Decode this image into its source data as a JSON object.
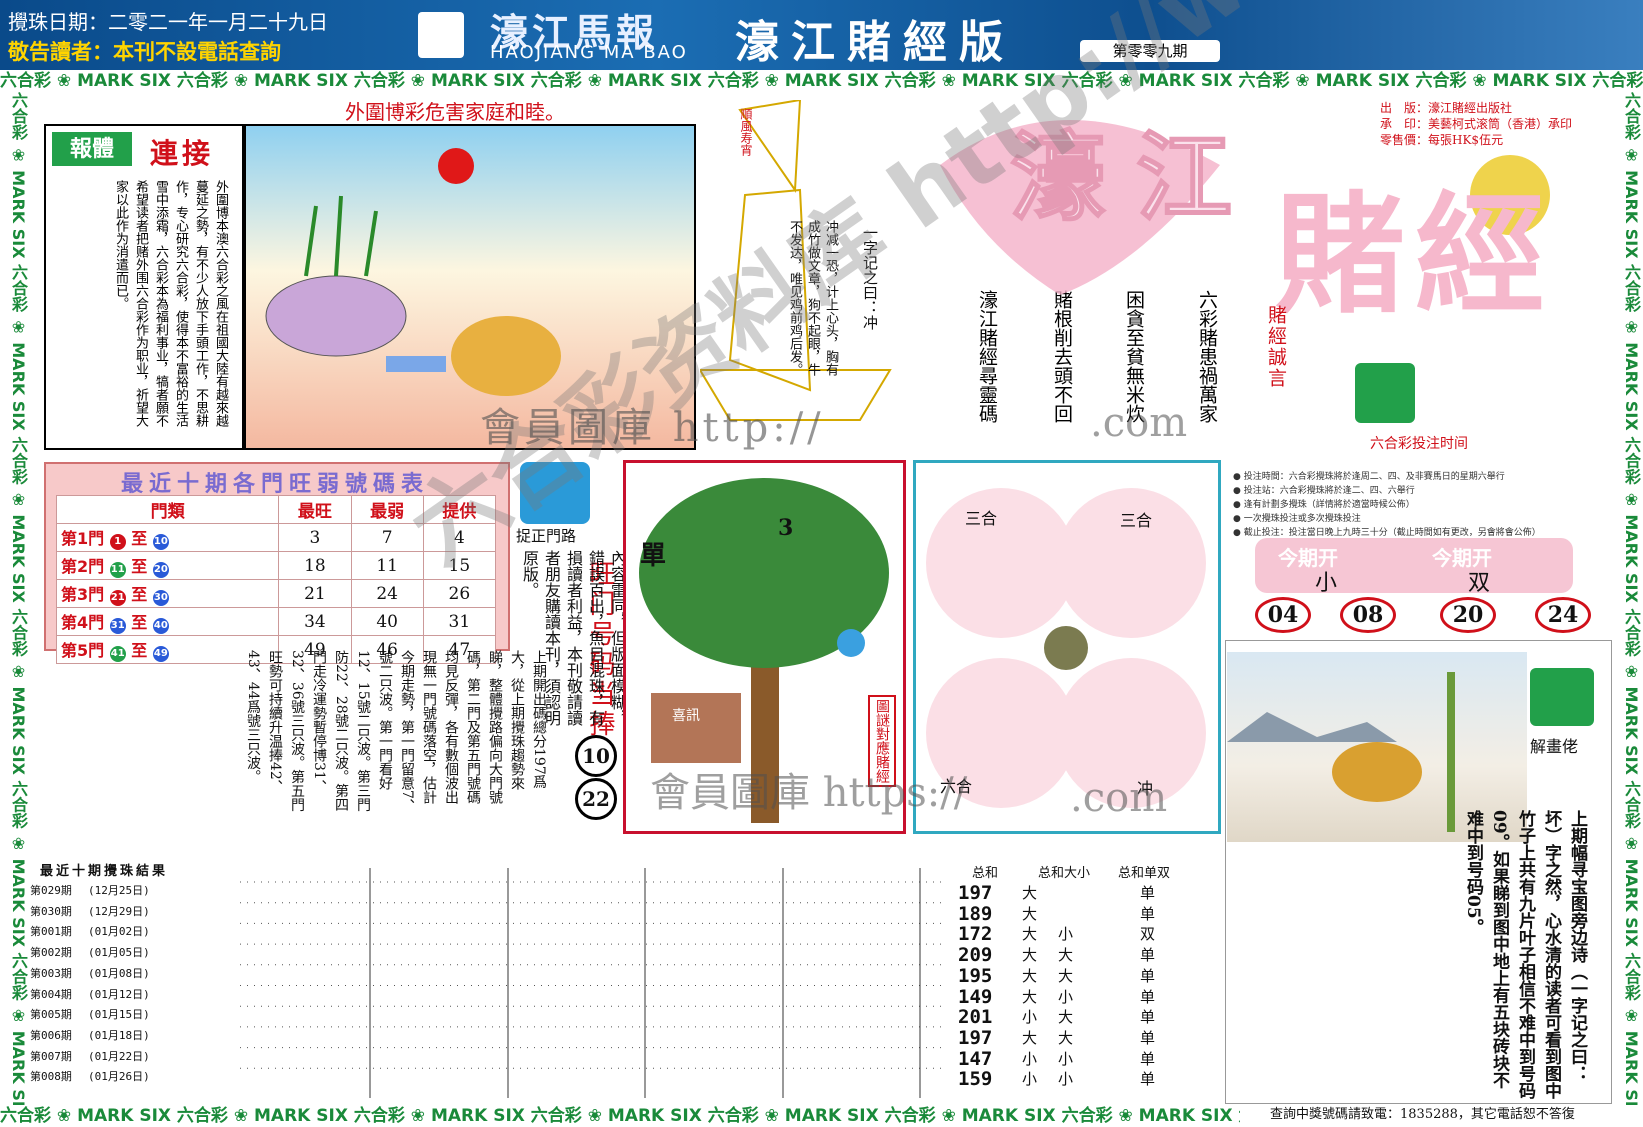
{
  "header": {
    "date_line": "攪珠日期：二零二一年一月二十九日",
    "notice": "敬告讀者：本刊不設電話查詢",
    "logo_cn": "濠江馬報",
    "logo_en": "HAOJIANG MA BAO",
    "edition": "濠江賭經版",
    "issue": "第零零九期"
  },
  "border": {
    "unit": "六合彩 ❀ MARK SIX "
  },
  "slogan": "外圍博彩危害家庭和睦。",
  "article": {
    "badge": "報體",
    "heading": "連接",
    "body": "外圍博本澳六合彩之風在祖國大陸有越來越蔓延之勢，有不少人放下手頭工作，不思耕作，专心研究六合彩，使得本不富裕的生活雪中添霜，六合彩本為福利事业，犒者願不希望读者把赌外围六合彩作为职业，祈望大家以此作为消遣而已。"
  },
  "boat": {
    "flag": "順風寿宵",
    "title": "一字记之曰：冲",
    "poem": "冲减一恐，计上心头，胸有成竹做文章，狗不起眼，牛不发达，唯见鸡前鸡后发。"
  },
  "verses": [
    "六彩賭患禍萬家",
    "困貪至貧無米炊",
    "賭根削去頭不回",
    "濠江賭經尋靈碼"
  ],
  "logo": {
    "big1": "濠江",
    "big2": "賭經",
    "motto": "賭經誠言",
    "bet_time": "六合彩投注时间"
  },
  "pub_info": [
    "出　版：濠江賭經出版社",
    "承　印：美藝柯式滚筒（香港）承印",
    "零售價：每張HK$伍元"
  ],
  "rank_table": {
    "title": "最近十期各門旺弱號碼表",
    "headers": [
      "門類",
      "最旺",
      "最弱",
      "提供"
    ],
    "rows": [
      {
        "gate": "第1門",
        "a": "1",
        "b": "10",
        "hot": "3",
        "weak": "7",
        "offer": "4"
      },
      {
        "gate": "第2門",
        "a": "11",
        "b": "20",
        "hot": "18",
        "weak": "11",
        "offer": "15"
      },
      {
        "gate": "第3門",
        "a": "21",
        "b": "30",
        "hot": "21",
        "weak": "24",
        "offer": "26"
      },
      {
        "gate": "第4門",
        "a": "31",
        "b": "40",
        "hot": "34",
        "weak": "40",
        "offer": "31"
      },
      {
        "gate": "第5門",
        "a": "41",
        "b": "49",
        "hot": "49",
        "weak": "46",
        "offer": "47"
      }
    ],
    "to": "至"
  },
  "gate_route": {
    "label": "捉正門路",
    "hot_title": "旺门号码当捧",
    "nums": [
      "10",
      "22"
    ],
    "notice": "敬告讀者：近期發現內地市場上有本刊的翻版，雖內容雷同，但版面模糊，錯誤百出，魚目混珠，有損讀者利益，本刊敬請讀者朋友購讀本刊，須認明原版。",
    "long": "上期開出碼總分197爲大，從上期攪珠趨勢來睇，整體攪路偏向大門號碼，第二門及第五門號碼均見反彈，各有數個波出現無一門號碼落空，估計今期走勢，第一門留意7、號二只波。第一門看好12、15號二只波。第三門防22、28號二只波。第四門走冷運勢暫停博31、32、36號三只波。第五門旺勢可持續升温捧42、43、44爲號三只波。"
  },
  "tree": {
    "left": "單",
    "num": "3",
    "side": "圖謎對應賭經",
    "caption": "喜訊"
  },
  "zodiac": {
    "tl": "三合",
    "tr": "三合",
    "bl": "六合",
    "br": "冲"
  },
  "bet_rules": [
    "● 投注時間：六合彩攪珠將於逢周二、四、及非賽馬日的星期六舉行",
    "● 投注站：六合彩攪珠將於逢二、四、六舉行",
    "● 逢有計劃多攪珠（詳情將於適當時候公佈）",
    "● 一次攪珠投注或多次攪珠投注",
    "● 截止投注：投注當日晚上九時三十分（截止時間如有更改，另會將會公佈）"
  ],
  "result_panel": {
    "hdr1": "今期开",
    "hdr2": "今期开",
    "val1": "小",
    "val2": "双",
    "balls": [
      "04",
      "08",
      "20",
      "24"
    ]
  },
  "riddle": {
    "label": "解畫佬",
    "text": "上期幅寻宝图旁边诗（一字记之曰：坏）字之然，心水清的读者可看到图中竹子上共有九片叶子相信不难中到号码09。如果睇到图中地上有五块砖块不难中到号码05。"
  },
  "results": {
    "title": "最近十期攪珠結果",
    "hdr_sum": "总和",
    "hdr_size": "总和大小",
    "hdr_odd": "总和单双",
    "rows": [
      {
        "issue": "第029期",
        "date": "(12月25日)",
        "sum": "197",
        "s1": "大",
        "s2": "",
        "odd": "单"
      },
      {
        "issue": "第030期",
        "date": "(12月29日)",
        "sum": "189",
        "s1": "大",
        "s2": "",
        "odd": "单"
      },
      {
        "issue": "第001期",
        "date": "(01月02日)",
        "sum": "172",
        "s1": "大",
        "s2": "小",
        "odd": "双"
      },
      {
        "issue": "第002期",
        "date": "(01月05日)",
        "sum": "209",
        "s1": "大",
        "s2": "大",
        "odd": "单"
      },
      {
        "issue": "第003期",
        "date": "(01月08日)",
        "sum": "195",
        "s1": "大",
        "s2": "大",
        "odd": "单"
      },
      {
        "issue": "第004期",
        "date": "(01月12日)",
        "sum": "149",
        "s1": "大",
        "s2": "小",
        "odd": "单"
      },
      {
        "issue": "第005期",
        "date": "(01月15日)",
        "sum": "201",
        "s1": "小",
        "s2": "大",
        "odd": "单"
      },
      {
        "issue": "第006期",
        "date": "(01月18日)",
        "sum": "197",
        "s1": "大",
        "s2": "大",
        "odd": "单"
      },
      {
        "issue": "第007期",
        "date": "(01月22日)",
        "sum": "147",
        "s1": "小",
        "s2": "小",
        "odd": "单"
      },
      {
        "issue": "第008期",
        "date": "(01月26日)",
        "sum": "159",
        "s1": "小",
        "s2": "小",
        "odd": "单"
      }
    ]
  },
  "watermarks": {
    "w1": "六合彩资料库 http://www.",
    "w2": "會員圖庫 http://",
    "w3": "會員圖庫 https://",
    "w4": ".com",
    "w5": ".com"
  },
  "hotline": "查詢中獎號碼請致電：1835288，其它電話恕不答復",
  "colors": {
    "red": "#d0101a",
    "green": "#1a8a3a",
    "header_blue": "#0a4a8a",
    "pink": "#f6c6d4"
  }
}
